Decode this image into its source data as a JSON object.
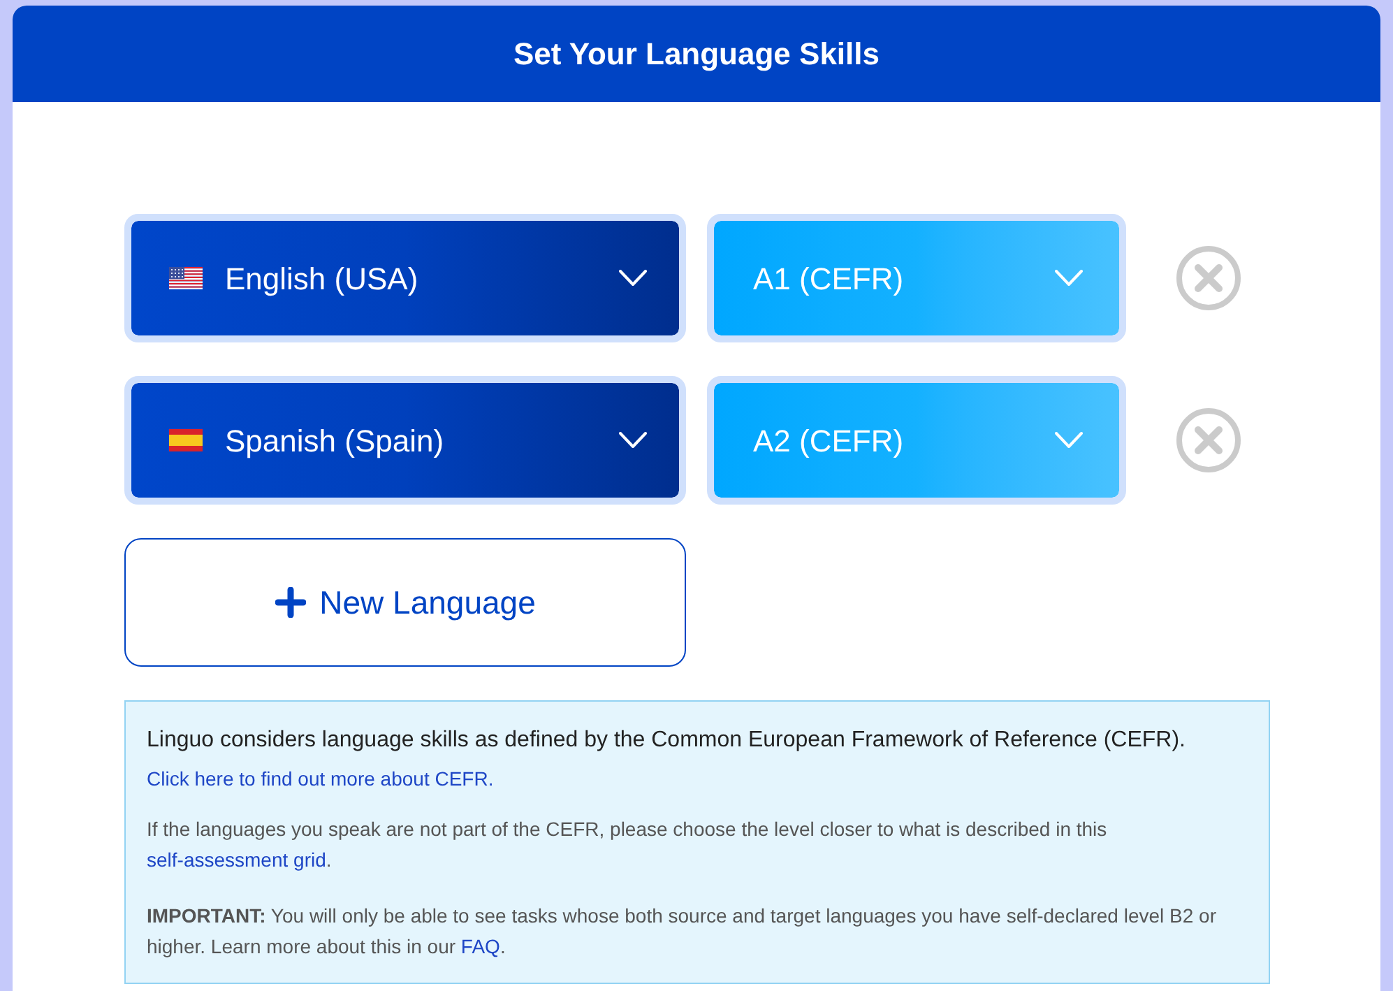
{
  "header": {
    "title": "Set Your Language Skills"
  },
  "languages": [
    {
      "kind": "us",
      "language": "English (USA)",
      "level": "A1 (CEFR)"
    },
    {
      "kind": "es",
      "language": "Spanish (Spain)",
      "level": "A2 (CEFR)"
    }
  ],
  "add_button": {
    "label": "New Language"
  },
  "info": {
    "intro": "Linguo considers language skills as defined by the Common European Framework of Reference (CEFR).",
    "intro_link": "Click here to find out more about CEFR.",
    "paragraphs": [
      {
        "text": "If the languages you speak are not part of the CEFR, please choose the level closer to what is described in this ",
        "link": "self-assessment grid",
        "after": "."
      },
      {
        "text": "**IMPORTANT:** You will only be able to see tasks whose both source and target languages you have self-declared level B2 or higher. Learn more about this in our ",
        "link": "FAQ",
        "after": "."
      }
    ]
  }
}
